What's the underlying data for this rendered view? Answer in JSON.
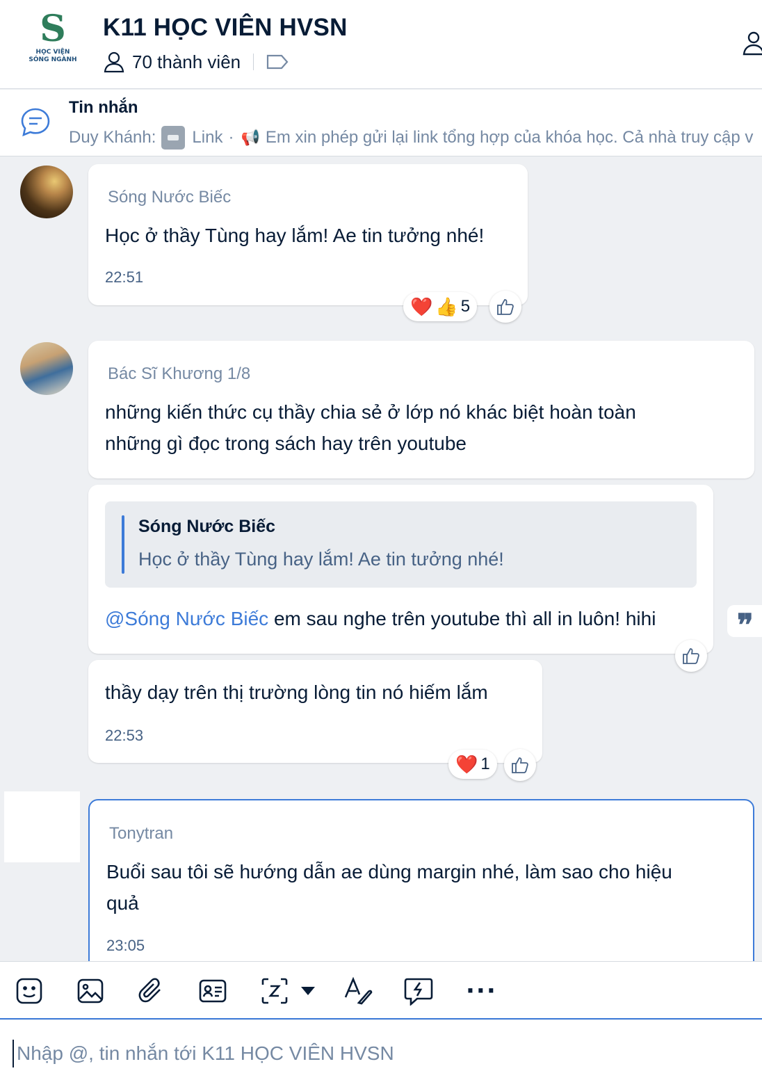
{
  "header": {
    "logo_letter": "S",
    "logo_line1": "HỌC VIỆN",
    "logo_line2": "SÓNG NGÀNH",
    "title": "K11 HỌC VIÊN HVSN",
    "members": "70 thành viên",
    "icons": [
      "user-icon",
      "tag-icon",
      "add-member-icon"
    ]
  },
  "pinned": {
    "title": "Tin nhắn",
    "sender": "Duy Khánh:",
    "link_label": "Link",
    "separator": "·",
    "preview": "Em xin phép gửi lại link tổng hợp của khóa học. Cả nhà truy cập v"
  },
  "messages": [
    {
      "sender": "Sóng Nước Biếc",
      "text": "Học ở thầy Tùng hay lắm! Ae tin tưởng nhé!",
      "time": "22:51",
      "reactions": {
        "emoji": [
          "❤️",
          "👍"
        ],
        "count": "5"
      }
    },
    {
      "sender": "Bác Sĩ Khương 1/8",
      "text_line1": "những kiến thức cụ thầy chia sẻ ở lớp nó khác biệt hoàn toàn",
      "text_line2": "những gì đọc trong sách hay trên youtube"
    },
    {
      "quote_name": "Sóng Nước Biếc",
      "quote_text": "Học ở thầy Tùng hay lắm! Ae tin tưởng nhé!",
      "mention": "@Sóng Nước Biếc",
      "text": " em sau nghe trên youtube thì all in luôn! hihi",
      "side_quote": "❞"
    },
    {
      "text": "thầy dạy trên thị trường lòng tin nó hiếm lắm",
      "time": "22:53",
      "reactions": {
        "emoji": [
          "❤️"
        ],
        "count": "1"
      }
    },
    {
      "sender": "Tonytran",
      "text_line1": "Buổi sau tôi sẽ hướng dẫn ae dùng margin nhé, làm sao cho hiệu",
      "text_line2": "quả",
      "time": "23:05"
    }
  ],
  "toolbar": {
    "icons": [
      "sticker-icon",
      "image-icon",
      "attachment-icon",
      "contact-card-icon",
      "screenshot-icon",
      "dropdown-icon",
      "text-format-icon",
      "quick-message-icon",
      "more-icon"
    ],
    "more_label": "···"
  },
  "input": {
    "placeholder": "Nhập @, tin nhắn tới K11 HỌC VIÊN HVSN"
  },
  "colors": {
    "accent": "#3d7bd8",
    "text_primary": "#081c36",
    "text_secondary": "#7589a3",
    "background": "#eef0f3"
  }
}
